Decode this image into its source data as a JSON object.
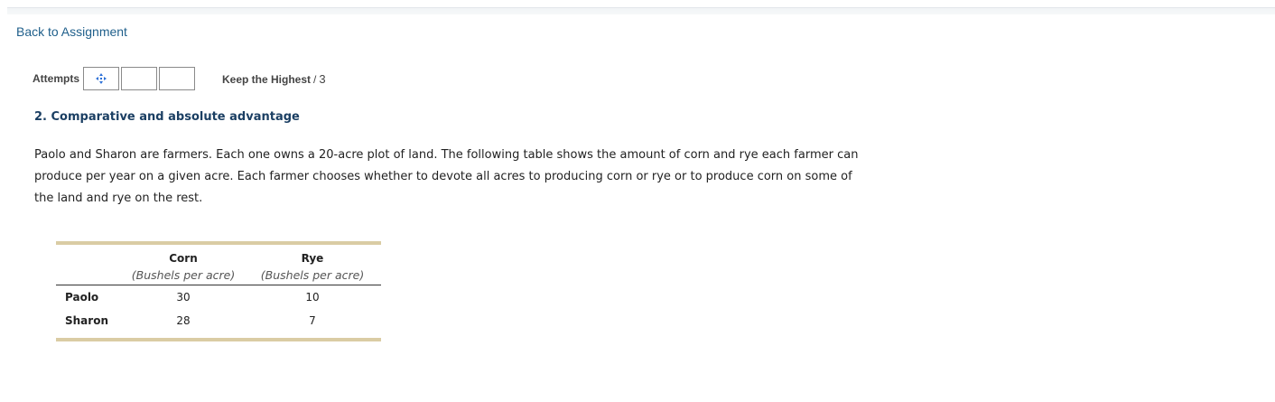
{
  "nav": {
    "back_link": "Back to Assignment"
  },
  "attempts": {
    "label": "Attempts",
    "boxes": [
      {
        "icon": "move-arrows-icon",
        "filled": true
      },
      {
        "icon": "",
        "filled": false
      },
      {
        "icon": "",
        "filled": false
      }
    ],
    "keep_highest_label": "Keep the Highest",
    "separator": "/",
    "total": "3"
  },
  "question": {
    "title": "2. Comparative and absolute advantage",
    "text": "Paolo and Sharon are farmers. Each one owns a 20-acre plot of land. The following table shows the amount of corn and rye each farmer can produce per year on a given acre. Each farmer chooses whether to devote all acres to producing corn or rye or to produce corn on some of the land and rye on the rest."
  },
  "table": {
    "columns": [
      {
        "name": "Corn",
        "unit": "(Bushels per acre)"
      },
      {
        "name": "Rye",
        "unit": "(Bushels per acre)"
      }
    ],
    "rows": [
      {
        "label": "Paolo",
        "values": [
          "30",
          "10"
        ]
      },
      {
        "label": "Sharon",
        "values": [
          "28",
          "7"
        ]
      }
    ]
  },
  "colors": {
    "link": "#1f5f8b",
    "title": "#1b3f63",
    "table_rule": "#dacca4",
    "icon_blue": "#2b6fd6"
  }
}
